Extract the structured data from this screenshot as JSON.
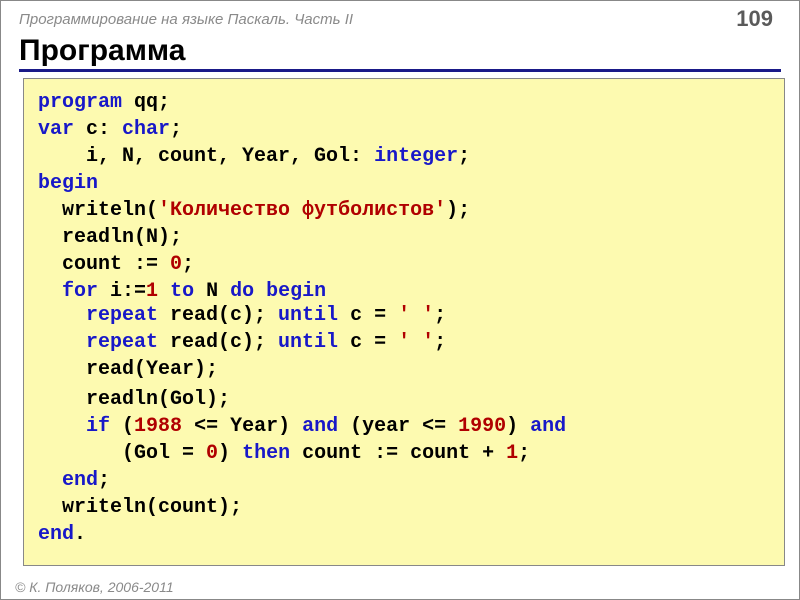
{
  "header": {
    "title": "Программирование на языке Паскаль. Часть II",
    "page": "109"
  },
  "section_title": "Программа",
  "code": {
    "l1_a": "program",
    "l1_b": " qq;",
    "l2_a": "var",
    "l2_b": " c: ",
    "l2_c": "char",
    "l2_d": ";",
    "l3_a": "    i, N, count, Year, Gol: ",
    "l3_b": "integer",
    "l3_c": ";",
    "l4": "begin",
    "l5_a": "  writeln(",
    "l5_b": "'Количество футболистов'",
    "l5_c": ");",
    "l6": "  readln(N);",
    "l7_a": "  count := ",
    "l7_b": "0",
    "l7_c": ";",
    "l8_a": "  ",
    "l8_b": "for",
    "l8_c": " i:=",
    "l8_d": "1",
    "l8_e": " ",
    "l8_f": "to",
    "l8_g": " N ",
    "l8_h": "do begin",
    "l9_a": "repeat",
    "l9_b": " read(c); ",
    "l9_c": "until",
    "l9_d": " c = ",
    "l9_e": "' '",
    "l9_f": ";",
    "l10_a": "repeat",
    "l10_b": " read(c); ",
    "l10_c": "until",
    "l10_d": " c = ",
    "l10_e": "' '",
    "l10_f": ";",
    "l11": "read(Year);",
    "l12": "    readln(Gol);",
    "l13_a": "    ",
    "l13_b": "if",
    "l13_c": " (",
    "l13_d": "1988",
    "l13_e": " <= Year) ",
    "l13_f": "and",
    "l13_g": " (year <= ",
    "l13_h": "1990",
    "l13_i": ") ",
    "l13_j": "and",
    "l14_a": "       (Gol = ",
    "l14_b": "0",
    "l14_c": ") ",
    "l14_d": "then",
    "l14_e": " count := count + ",
    "l14_f": "1",
    "l14_g": ";",
    "l15_a": "  ",
    "l15_b": "end",
    "l15_c": ";",
    "l16": "  writeln(count);",
    "l17_a": "end",
    "l17_b": "."
  },
  "footer": "© К. Поляков, 2006-2011"
}
